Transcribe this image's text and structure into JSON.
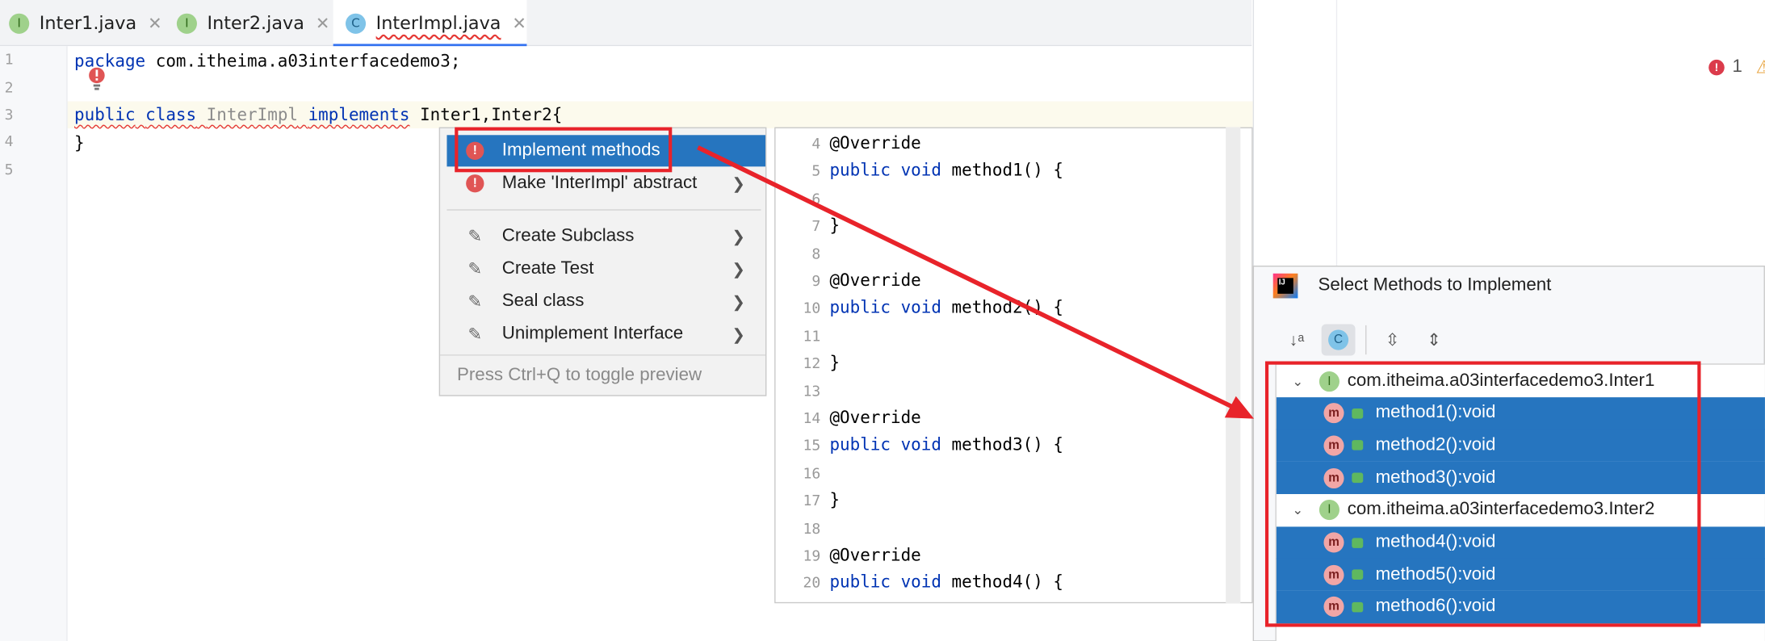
{
  "tabs": [
    {
      "icon": "I",
      "label": "Inter1.java"
    },
    {
      "icon": "I",
      "label": "Inter2.java"
    },
    {
      "icon": "C",
      "label": "InterImpl.java"
    }
  ],
  "editor": {
    "line_numbers": [
      "1",
      "2",
      "3",
      "4",
      "5"
    ],
    "line1": {
      "kw": "package",
      "rest": " com.itheima.a03interfacedemo3;"
    },
    "line3": {
      "kw1": "public",
      "kw2": "class",
      "classname": "InterImpl",
      "kw3": "implements",
      "rest": " Inter1,Inter2{"
    },
    "line4": "}"
  },
  "problems": {
    "error_count": "1"
  },
  "context_menu": {
    "items": [
      {
        "label": "Implement methods"
      },
      {
        "label": "Make 'InterImpl' abstract"
      },
      {
        "label": "Create Subclass"
      },
      {
        "label": "Create Test"
      },
      {
        "label": "Seal class"
      },
      {
        "label": "Unimplement Interface"
      }
    ],
    "hint": "Press Ctrl+Q to toggle preview"
  },
  "preview": {
    "lines": [
      {
        "n": "4",
        "text": "@Override"
      },
      {
        "n": "5",
        "kw": "public void",
        "text": " method1() {"
      },
      {
        "n": "6",
        "text": ""
      },
      {
        "n": "7",
        "text": "}"
      },
      {
        "n": "8",
        "text": ""
      },
      {
        "n": "9",
        "text": "@Override"
      },
      {
        "n": "10",
        "kw": "public void",
        "text": " method2() {"
      },
      {
        "n": "11",
        "text": ""
      },
      {
        "n": "12",
        "text": "}"
      },
      {
        "n": "13",
        "text": ""
      },
      {
        "n": "14",
        "text": "@Override"
      },
      {
        "n": "15",
        "kw": "public void",
        "text": " method3() {"
      },
      {
        "n": "16",
        "text": ""
      },
      {
        "n": "17",
        "text": "}"
      },
      {
        "n": "18",
        "text": ""
      },
      {
        "n": "19",
        "text": "@Override"
      },
      {
        "n": "20",
        "kw": "public void",
        "text": " method4() {"
      }
    ]
  },
  "dialog": {
    "title": "Select Methods to Implement",
    "groups": [
      {
        "name": "com.itheima.a03interfacedemo3.Inter1",
        "methods": [
          "method1():void",
          "method2():void",
          "method3():void"
        ]
      },
      {
        "name": "com.itheima.a03interfacedemo3.Inter2",
        "methods": [
          "method4():void",
          "method5():void",
          "method6():void"
        ]
      }
    ]
  },
  "colors": {
    "selection": "#2675bf",
    "annotation": "#e8232a"
  }
}
